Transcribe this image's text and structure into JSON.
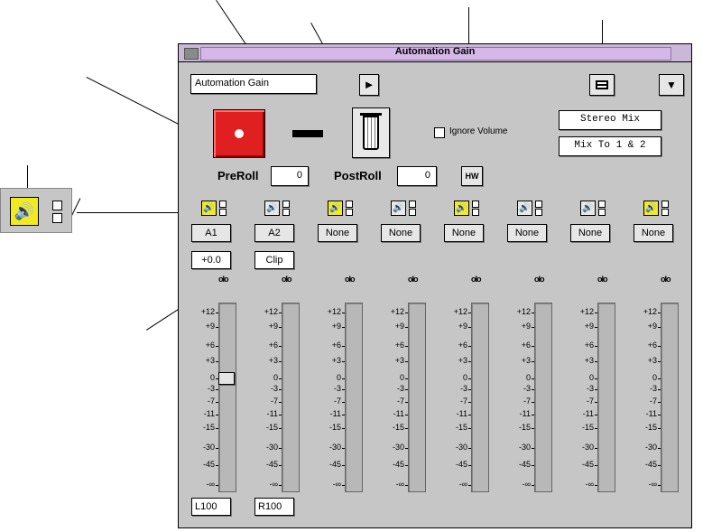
{
  "window": {
    "title": "Automation Gain"
  },
  "toolbar": {
    "mode_select": "Automation Gain"
  },
  "controls": {
    "ignore_volume_label": "Ignore Volume",
    "output_1": "Stereo Mix",
    "output_2": "Mix To 1 & 2",
    "preroll_label": "PreRoll",
    "preroll_value": "0",
    "postroll_label": "PostRoll",
    "postroll_value": "0",
    "hw_label": "HW"
  },
  "channels": [
    {
      "source": "A1",
      "value": "+0.0",
      "pan": "L100",
      "speaker_active": true,
      "fader_level_db": 0
    },
    {
      "source": "A2",
      "value": "Clip",
      "pan": "R100",
      "speaker_active": false
    },
    {
      "source": "None",
      "speaker_active": true
    },
    {
      "source": "None",
      "speaker_active": false
    },
    {
      "source": "None",
      "speaker_active": true
    },
    {
      "source": "None",
      "speaker_active": false
    },
    {
      "source": "None",
      "speaker_active": false
    },
    {
      "source": "None",
      "speaker_active": true
    }
  ],
  "scale_ticks": [
    "+12",
    "+9",
    "+6",
    "+3",
    "0",
    "-3",
    "-7",
    "-11",
    "-15",
    "-30",
    "-45",
    "-∞"
  ],
  "link_icon_text": "oIo",
  "colors": {
    "record_button": "#e02020",
    "speaker_active": "#f2ea20",
    "title_bar": "#d6b8e8",
    "window_bg": "#c6c6c6"
  }
}
